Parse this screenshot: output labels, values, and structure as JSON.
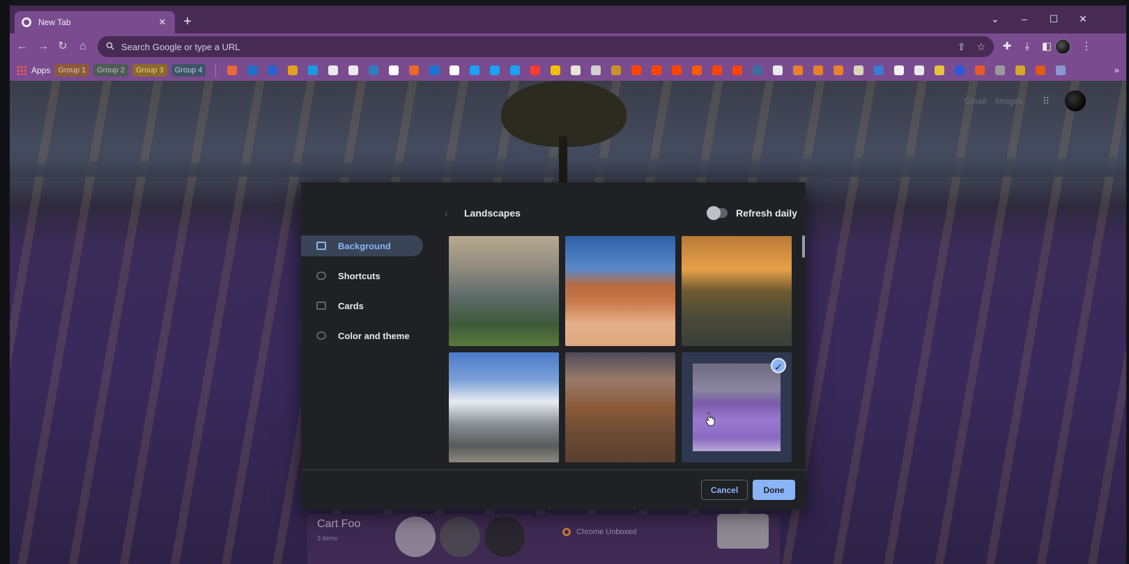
{
  "browser": {
    "tab": {
      "title": "New Tab"
    },
    "window_controls": {
      "tabsearch": "⌄",
      "minimize": "–",
      "maximize": "☐",
      "close": "✕"
    },
    "toolbar": {
      "back": "←",
      "forward": "→",
      "reload": "↻",
      "home": "⌂"
    },
    "omnibox": {
      "placeholder": "Search Google or type a URL",
      "share": "⇪",
      "star": "☆"
    },
    "extensions": {
      "puzzle": "✚",
      "download": "⤓",
      "sidepanel": "◧",
      "menu": "⋮"
    }
  },
  "bookmarks": {
    "apps_label": "Apps",
    "groups": [
      {
        "label": "Group 1",
        "color": "#8a5a3c",
        "text": "#e8c4a8"
      },
      {
        "label": "Group 2",
        "color": "#4e5a56",
        "text": "#b8c4c0"
      },
      {
        "label": "Group 3",
        "color": "#8a6a2c",
        "text": "#f0d080"
      },
      {
        "label": "Group 4",
        "color": "#3f5466",
        "text": "#b8cde0"
      }
    ],
    "icon_colors": [
      "#e86a3a",
      "#1e73c8",
      "#2a62c9",
      "#e0a020",
      "#1a9be0",
      "#e8eaed",
      "#e8eaed",
      "#2d7fc1",
      "#ffffff",
      "#e6692d",
      "#1976d2",
      "#ffffff",
      "#1da1f2",
      "#1da1f2",
      "#1da1f2",
      "#ff3b30",
      "#f2c200",
      "#e9e4d4",
      "#d0d0d0",
      "#c8922a",
      "#ff4500",
      "#ff4500",
      "#ff4500",
      "#ff5a00",
      "#ff4500",
      "#ff4500",
      "#3a6ea5",
      "#e8eaed",
      "#e8812b",
      "#e8812b",
      "#e8812b",
      "#d8d4c0",
      "#3a7bd5",
      "#f4f4f4",
      "#e8eaed",
      "#e8c43a",
      "#2a5bd7",
      "#e85a2a",
      "#9a9a9a",
      "#d9a72a",
      "#e05a1a",
      "#8a9ad0"
    ],
    "more": "»"
  },
  "ntp": {
    "links": {
      "gmail": "Gmail",
      "images": "Images"
    },
    "apps_glyph": "⠿",
    "cards": {
      "cart": {
        "title": "Cart Foo",
        "subtitle": "3 items"
      },
      "recent": {
        "label": "Chrome Unboxed"
      }
    }
  },
  "customize": {
    "back_glyph": "‹",
    "collection_title": "Landscapes",
    "refresh_label": "Refresh daily",
    "refresh_on": false,
    "sidebar": [
      {
        "label": "Background",
        "active": true
      },
      {
        "label": "Shortcuts",
        "active": false
      },
      {
        "label": "Cards",
        "active": false
      },
      {
        "label": "Color and theme",
        "active": false
      }
    ],
    "backgrounds": [
      {
        "name": "rocky-lake",
        "selected": false
      },
      {
        "name": "delicate-arch",
        "selected": false
      },
      {
        "name": "canyon-sunset",
        "selected": false
      },
      {
        "name": "snowy-mountain",
        "selected": false
      },
      {
        "name": "desert-valley",
        "selected": false
      },
      {
        "name": "lavender-field",
        "selected": true
      }
    ],
    "check_glyph": "✓",
    "buttons": {
      "cancel": "Cancel",
      "done": "Done"
    }
  }
}
